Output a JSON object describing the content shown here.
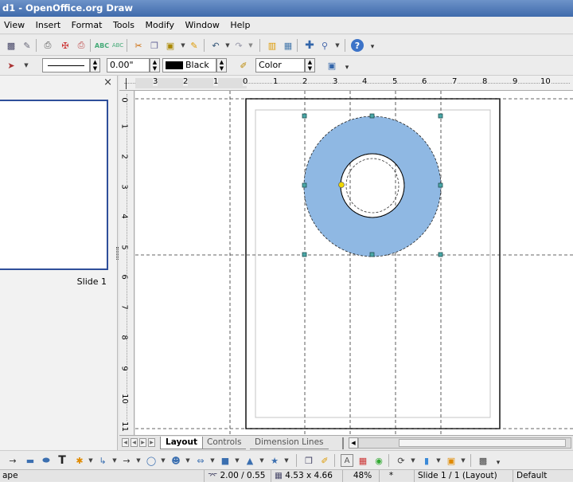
{
  "window": {
    "title": "d1 - OpenOffice.org Draw"
  },
  "menu": [
    "View",
    "Insert",
    "Format",
    "Tools",
    "Modify",
    "Window",
    "Help"
  ],
  "line_toolbar": {
    "line_width": "0.00\"",
    "line_color": "Black",
    "area_style": "Color"
  },
  "slides_panel": {
    "close_glyph": "×",
    "slide_label": "Slide 1"
  },
  "rulers": {
    "horizontal": [
      "3",
      "2",
      "1",
      "0",
      "1",
      "2",
      "3",
      "4",
      "5",
      "6",
      "7",
      "8",
      "9",
      "10"
    ],
    "vertical": [
      "0",
      "1",
      "2",
      "3",
      "4",
      "5",
      "6",
      "7",
      "8",
      "9",
      "10",
      "11"
    ]
  },
  "layer_tabs": [
    "Layout",
    "Controls",
    "Dimension Lines"
  ],
  "status": {
    "left": "ape",
    "position": "2.00 / 0.55",
    "size": "4.53 x 4.66",
    "zoom": "48%",
    "modified": "*",
    "slide": "Slide 1 / 1 (Layout)",
    "style": "Default"
  },
  "colors": {
    "ring_fill": "#8fb8e3",
    "title_bar": "#4a74b3",
    "slide_border": "#2f4f9a",
    "handle": "#3a9090"
  }
}
